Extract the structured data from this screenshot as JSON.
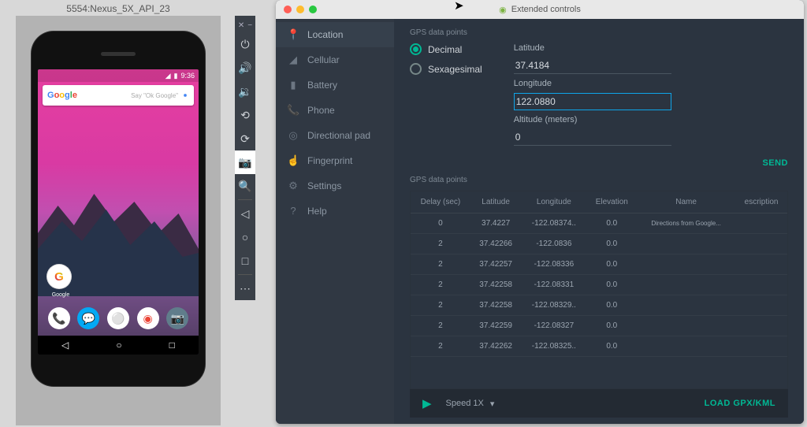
{
  "emu_title": "5554:Nexus_5X_API_23",
  "phone": {
    "time": "9:36",
    "search_hint": "Say \"Ok Google\"",
    "google_label": "Google"
  },
  "ext": {
    "title": "Extended controls",
    "sidebar": [
      {
        "icon": "📍",
        "label": "Location",
        "active": true
      },
      {
        "icon": "◢",
        "label": "Cellular"
      },
      {
        "icon": "▮",
        "label": "Battery"
      },
      {
        "icon": "📞",
        "label": "Phone"
      },
      {
        "icon": "◎",
        "label": "Directional pad"
      },
      {
        "icon": "☝",
        "label": "Fingerprint"
      },
      {
        "icon": "⚙",
        "label": "Settings"
      },
      {
        "icon": "?",
        "label": "Help"
      }
    ],
    "section1": "GPS data points",
    "radio": {
      "decimal": "Decimal",
      "sexagesimal": "Sexagesimal"
    },
    "fields": {
      "lat_label": "Latitude",
      "lat_val": "37.4184",
      "lon_label": "Longitude",
      "lon_val": "122.0880",
      "alt_label": "Altitude (meters)",
      "alt_val": "0"
    },
    "send": "SEND",
    "section2": "GPS data points",
    "cols": [
      "Delay (sec)",
      "Latitude",
      "Longitude",
      "Elevation",
      "Name",
      "escription"
    ],
    "rows": [
      [
        "0",
        "37.4227",
        "-122.08374..",
        "0.0",
        "Directions from Google...",
        ""
      ],
      [
        "2",
        "37.42266",
        "-122.0836",
        "0.0",
        "",
        ""
      ],
      [
        "2",
        "37.42257",
        "-122.08336",
        "0.0",
        "",
        ""
      ],
      [
        "2",
        "37.42258",
        "-122.08331",
        "0.0",
        "",
        ""
      ],
      [
        "2",
        "37.42258",
        "-122.08329..",
        "0.0",
        "",
        ""
      ],
      [
        "2",
        "37.42259",
        "-122.08327",
        "0.0",
        "",
        ""
      ],
      [
        "2",
        "37.42262",
        "-122.08325..",
        "0.0",
        "",
        ""
      ]
    ],
    "speed": "Speed 1X",
    "load": "LOAD GPX/KML"
  }
}
